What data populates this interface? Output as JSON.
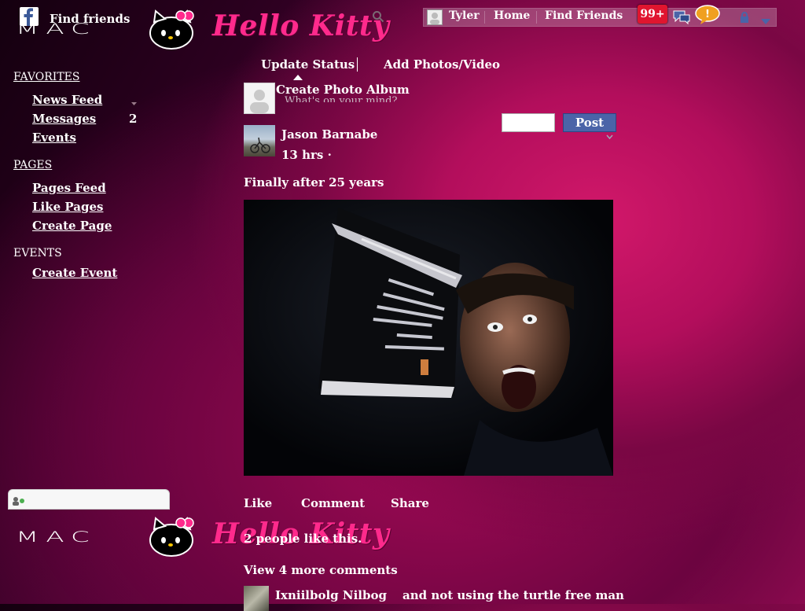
{
  "header": {
    "find_friends": "Find friends",
    "brand_mac": "MAC",
    "brand_hello_kitty": "Hello Kitty"
  },
  "topbar": {
    "user": "Tyler",
    "home": "Home",
    "find_friends": "Find Friends",
    "notifications": "99+"
  },
  "sidebar": {
    "favorites_header": "FAVORITES",
    "favorites": [
      {
        "label": "News Feed"
      },
      {
        "label": "Messages",
        "count": "2"
      },
      {
        "label": "Events"
      }
    ],
    "pages_header": "PAGES",
    "pages": [
      {
        "label": "Pages Feed"
      },
      {
        "label": "Like Pages"
      },
      {
        "label": "Create Page"
      }
    ],
    "events_header": "EVENTS",
    "events": [
      {
        "label": "Create Event"
      }
    ]
  },
  "composer": {
    "tabs": [
      "Update Status",
      "Add Photos/Video",
      "Create Photo Album"
    ],
    "placeholder": "What's on your mind?",
    "post_button": "Post"
  },
  "post": {
    "author": "Jason Barnabe",
    "time": "13 hrs ·",
    "text": "Finally after 25 years",
    "actions": [
      "Like",
      "Comment",
      "Share"
    ],
    "likes": "2 people like this.",
    "more_comments": "View 4 more comments",
    "comment_author": "Ixniilbolg Nilbog",
    "comment_text": "and not using the turtle free man"
  },
  "colors": {
    "accent_pink": "#ff2a8c",
    "badge_red": "#e0152f",
    "post_blue": "#4a64a8"
  },
  "icons": [
    "facebook-icon",
    "search-icon",
    "friend-requests-icon",
    "messages-icon",
    "notifications-icon",
    "privacy-lock-icon",
    "account-dropdown-icon",
    "chat-user-icon"
  ]
}
